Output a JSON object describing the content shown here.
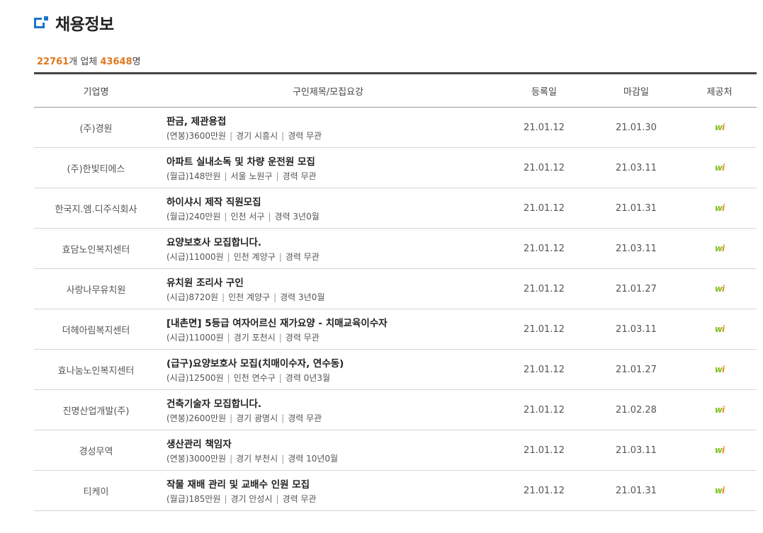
{
  "page": {
    "title": "채용정보"
  },
  "counts": {
    "postings": "22761",
    "postings_unit": "개 업체",
    "people": "43648",
    "people_unit": "명"
  },
  "table": {
    "headers": {
      "company": "기업명",
      "title": "구인제목/모집요강",
      "registered": "등록일",
      "deadline": "마감일",
      "source": "제공처"
    },
    "rows": [
      {
        "company": "(주)경원",
        "title": "판금, 제관용접",
        "pay": "(연봉)3600만원",
        "location": "경기 시흥시",
        "experience": "경력 무관",
        "registered": "21.01.12",
        "deadline": "21.01.30"
      },
      {
        "company": "(주)한빛티에스",
        "title": "아파트 실내소독 및 차량 운전원 모집",
        "pay": "(월급)148만원",
        "location": "서울 노원구",
        "experience": "경력 무관",
        "registered": "21.01.12",
        "deadline": "21.03.11"
      },
      {
        "company": "한국지.엠.디주식회사",
        "title": "하이샤시 제작 직원모집",
        "pay": "(월급)240만원",
        "location": "인천 서구",
        "experience": "경력 3년0월",
        "registered": "21.01.12",
        "deadline": "21.01.31"
      },
      {
        "company": "효담노인복지센터",
        "title": "요양보호사 모집합니다.",
        "pay": "(시급)11000원",
        "location": "인천 계양구",
        "experience": "경력 무관",
        "registered": "21.01.12",
        "deadline": "21.03.11"
      },
      {
        "company": "사랑나무유치원",
        "title": "유치원 조리사 구인",
        "pay": "(시급)8720원",
        "location": "인천 계양구",
        "experience": "경력 3년0월",
        "registered": "21.01.12",
        "deadline": "21.01.27"
      },
      {
        "company": "더헤아림복지센터",
        "title": "[내촌면] 5등급 여자어르신 재가요양 - 치매교육이수자",
        "pay": "(시급)11000원",
        "location": "경기 포천시",
        "experience": "경력 무관",
        "registered": "21.01.12",
        "deadline": "21.03.11"
      },
      {
        "company": "효나눔노인복지센터",
        "title": "(급구)요양보호사 모집(치매이수자, 연수동)",
        "pay": "(시급)12500원",
        "location": "인천 연수구",
        "experience": "경력 0년3월",
        "registered": "21.01.12",
        "deadline": "21.01.27"
      },
      {
        "company": "진명산업개발(주)",
        "title": "건축기술자 모집합니다.",
        "pay": "(연봉)2600만원",
        "location": "경기 광명시",
        "experience": "경력 무관",
        "registered": "21.01.12",
        "deadline": "21.02.28"
      },
      {
        "company": "경성무역",
        "title": "생산관리 책임자",
        "pay": "(연봉)3000만원",
        "location": "경기 부천시",
        "experience": "경력 10년0월",
        "registered": "21.01.12",
        "deadline": "21.03.11"
      },
      {
        "company": "티케이",
        "title": "작물 재배 관리 및 교배수 인원 모집",
        "pay": "(월급)185만원",
        "location": "경기 안성시",
        "experience": "경력 무관",
        "registered": "21.01.12",
        "deadline": "21.01.31"
      }
    ]
  },
  "icons": {
    "title_icon": "section-bracket-icon",
    "source_icon": "worknet-logo-icon",
    "source_icon_colors": {
      "w": "#7ec11f",
      "i": "#f08a1c"
    },
    "accent": "#1a73c9",
    "count_color": "#e0771d"
  }
}
